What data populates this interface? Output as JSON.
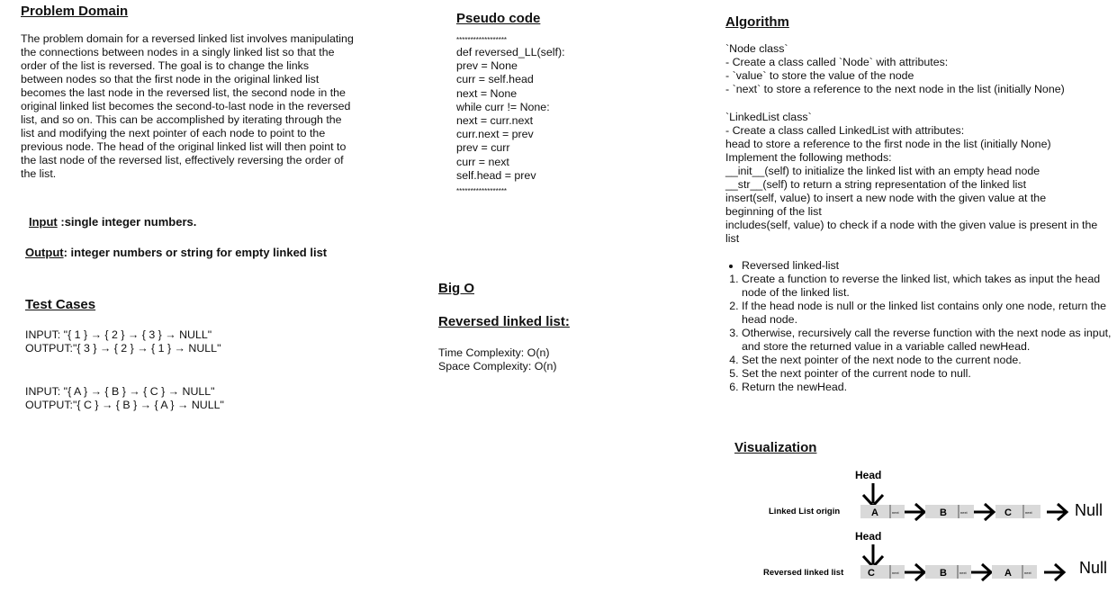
{
  "problem": {
    "heading": "Problem Domain",
    "text": "The problem domain for a reversed linked list involves manipulating the connections between nodes in a singly linked list so that the order of the list is reversed. The goal is to change the links between nodes so that the first node in the original linked list becomes the last node in the reversed list, the second node in the original linked list becomes the second-to-last node in the reversed list, and so on. This can be accomplished by iterating through the list and modifying the next pointer of each node to point to the previous node. The head of the original linked list will then point to the last node of the reversed list, effectively reversing the order of the list."
  },
  "io": {
    "input_label": "Input",
    "input_text": " :single integer numbers.",
    "output_label": "Output",
    "output_text": ":  integer numbers or string for empty linked list"
  },
  "tests": {
    "heading": "Test Cases",
    "cases": [
      {
        "input": "INPUT: \"{ 1 } → { 2 } → { 3 } → NULL\"",
        "output": "OUTPUT:\"{ 3 } → { 2 } → { 1 } → NULL\""
      },
      {
        "input": "INPUT: \"{ A } → { B } → { C } → NULL\"",
        "output": "OUTPUT:\"{ C } → { B } → { A } → NULL\""
      }
    ]
  },
  "pseudo": {
    "heading": "Pseudo code",
    "separator": "******************",
    "lines": [
      "def reversed_LL(self):",
      "prev = None",
      "curr = self.head",
      "next = None",
      "while curr != None:",
      "next = curr.next",
      "curr.next = prev",
      "prev = curr",
      "curr = next",
      "self.head = prev"
    ]
  },
  "bigo": {
    "heading": "Big O",
    "subheading": "Reversed linked list:",
    "time": "Time Complexity: O(n)",
    "space": "Space Complexity: O(n)"
  },
  "algorithm": {
    "heading": "Algorithm ",
    "node_title": "`Node class`",
    "node_lines": [
      "- Create a class called `Node` with attributes:",
      "- `value` to store the value of the node",
      "- `next` to store a reference to the next node in the list (initially None)"
    ],
    "ll_title": "`LinkedList class`",
    "ll_lines": [
      "- Create a class called LinkedList with attributes:",
      "head to store a reference to the first node in the list (initially None)",
      "Implement the following methods:",
      "__init__(self) to initialize the linked list with an empty head node",
      "__str__(self) to return a string representation of the linked list",
      "insert(self, value) to insert a new node with the given value at the beginning of the list",
      "includes(self, value) to check if a node with the given value is present in the list"
    ],
    "bullet": "Reversed linked-list",
    "steps": [
      "Create a function to reverse the linked list, which takes as input the head node of the linked list.",
      "If the head node is null or the linked list contains only one node, return the head node.",
      "Otherwise, recursively call the reverse function with the next node as input, and store the returned value in a variable called newHead.",
      "Set the next pointer of the next node to the current node.",
      "Set the next pointer of the current node to null.",
      "Return the newHead."
    ]
  },
  "viz": {
    "heading": "Visualization",
    "head_label": "Head",
    "next_label": "next",
    "null_label": "Null",
    "origin": {
      "label": "Linked List origin",
      "nodes": [
        "A",
        "B",
        "C"
      ]
    },
    "reversed": {
      "label": "Reversed linked list",
      "nodes": [
        "C",
        "B",
        "A"
      ]
    }
  }
}
